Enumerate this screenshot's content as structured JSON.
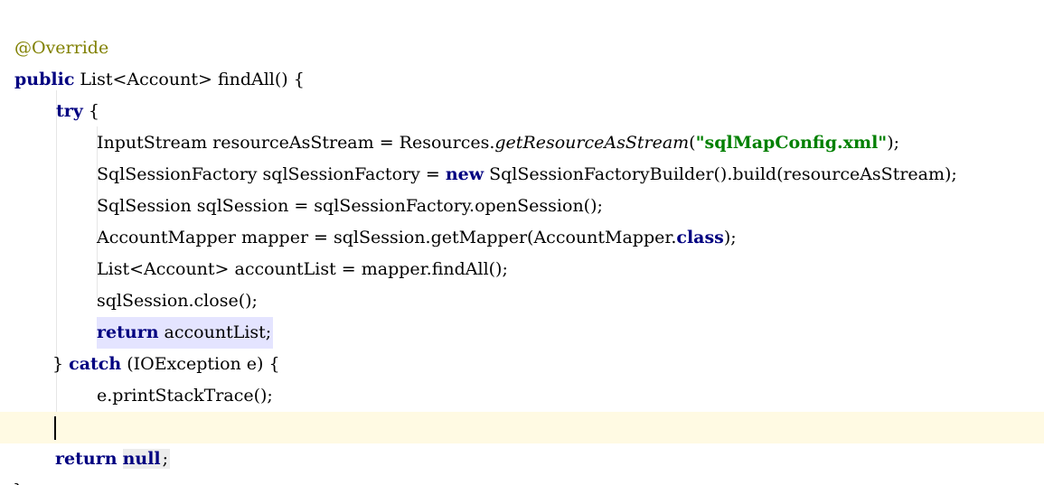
{
  "editor": {
    "lines": {
      "l1": {
        "annotation": "@Override"
      },
      "l2": {
        "kw_public": "public",
        "text": " List<Account> findAll() {"
      },
      "l3": {
        "kw_try": "try",
        "text": " {"
      },
      "l4": {
        "pre": "InputStream resourceAsStream = Resources.",
        "method": "getResourceAsStream",
        "open": "(",
        "string": "\"sqlMapConfig.xml\"",
        "post": ");"
      },
      "l5": {
        "pre": "SqlSessionFactory sqlSessionFactory = ",
        "kw_new": "new",
        "post": " SqlSessionFactoryBuilder().build(resourceAsStream);"
      },
      "l6": {
        "text": "SqlSession sqlSession = sqlSessionFactory.openSession();"
      },
      "l7": {
        "pre": "AccountMapper mapper = sqlSession.getMapper(AccountMapper.",
        "kw_class": "class",
        "post": ");"
      },
      "l8": {
        "text": "List<Account> accountList = mapper.findAll();"
      },
      "l9": {
        "text": "sqlSession.close();"
      },
      "l10": {
        "kw_return": "return",
        "post": " accountList;"
      },
      "l11": {
        "pre": "} ",
        "kw_catch": "catch",
        "post": " (IOException e) {"
      },
      "l12": {
        "text": "e.printStackTrace();"
      },
      "l13": {
        "text": "}"
      },
      "l14": {
        "kw_return": "return",
        "mid": " ",
        "kw_null": "null",
        "post": ";"
      },
      "l15": {
        "text": "}"
      }
    },
    "colors": {
      "keyword": "#000080",
      "annotation": "#808000",
      "string": "#008000",
      "current_line": "#fffae3"
    }
  }
}
